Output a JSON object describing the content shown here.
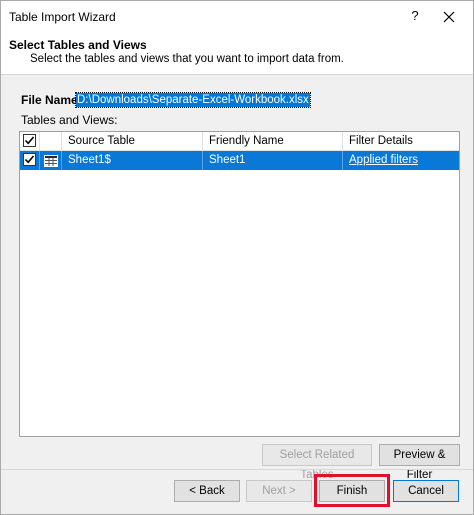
{
  "window": {
    "title": "Table Import Wizard",
    "help_label": "?",
    "close_icon": "close-icon"
  },
  "header": {
    "title": "Select Tables and Views",
    "subtitle": "Select the tables and views that you want to import data from."
  },
  "file": {
    "label": "File Name:",
    "value": "D:\\Downloads\\Separate-Excel-Workbook.xlsx"
  },
  "tables_label": "Tables and Views:",
  "grid": {
    "columns": [
      "Source Table",
      "Friendly Name",
      "Filter Details"
    ],
    "rows": [
      {
        "checked": true,
        "source": "Sheet1$",
        "friendly": "Sheet1",
        "filter": "Applied filters",
        "icon": "table-grid-icon"
      }
    ]
  },
  "buttons": {
    "select_related": "Select Related Tables",
    "preview_filter": "Preview & Filter",
    "back": "< Back",
    "next": "Next >",
    "finish": "Finish",
    "cancel": "Cancel"
  },
  "colors": {
    "selection": "#0078d7",
    "highlight": "#e0102a"
  }
}
